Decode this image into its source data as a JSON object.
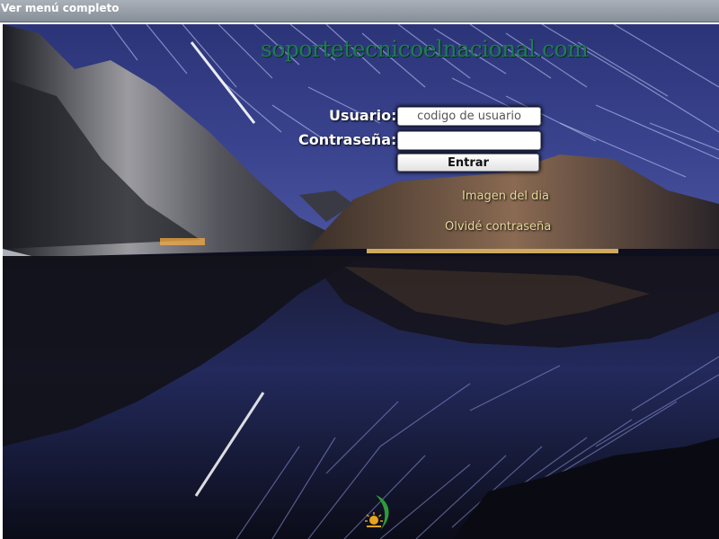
{
  "topbar": {
    "menu_link": "Ver menú completo"
  },
  "site": {
    "domain": "soportetecnicoelnacional.com"
  },
  "login": {
    "user_label": "Usuario:",
    "user_placeholder": "codigo de usuario",
    "user_value": "",
    "password_label": "Contraseña:",
    "password_value": "",
    "submit_label": "Entrar"
  },
  "links": {
    "image_of_day": "Imagen del dia",
    "forgot_password": "Olvidé contraseña"
  },
  "footer": {
    "logo": "sun-leaf-logo-icon"
  },
  "colors": {
    "topbar": "#868e98",
    "domain_text": "#1f7a57",
    "link_text": "#e8d79a",
    "sky": "#2a3270",
    "water": "#0d0f1f"
  }
}
